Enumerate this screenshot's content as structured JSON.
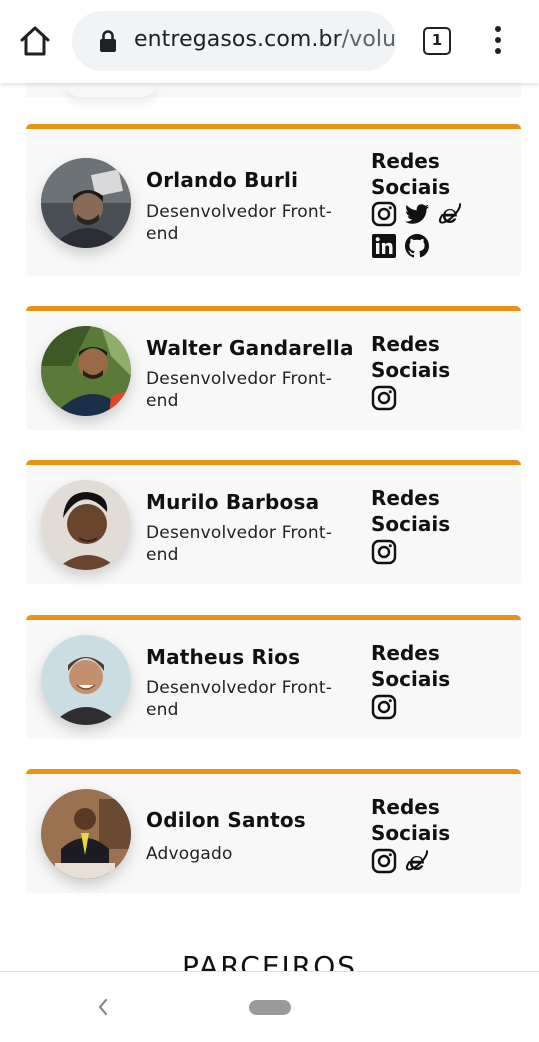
{
  "browser": {
    "url_host": "entregasos.com.br",
    "url_path": "/volu",
    "tab_count": "1"
  },
  "members": [
    {
      "name": "Orlando Burli",
      "role": "Desenvolvedor Front-end",
      "social_title": "Redes Sociais",
      "icons": [
        "instagram-icon",
        "twitter-icon",
        "internet-explorer-icon",
        "linkedin-icon",
        "github-icon"
      ]
    },
    {
      "name": "Walter Gandarella",
      "role": "Desenvolvedor Front-end",
      "social_title": "Redes Sociais",
      "icons": [
        "instagram-icon"
      ]
    },
    {
      "name": "Murilo Barbosa",
      "role": "Desenvolvedor Front-end",
      "social_title": "Redes Sociais",
      "icons": [
        "instagram-icon"
      ]
    },
    {
      "name": "Matheus Rios",
      "role": "Desenvolvedor Front-end",
      "social_title": "Redes Sociais",
      "icons": [
        "instagram-icon"
      ]
    },
    {
      "name": "Odilon Santos",
      "role": "Advogado",
      "social_title": "Redes Sociais",
      "icons": [
        "instagram-icon",
        "internet-explorer-icon"
      ]
    }
  ],
  "partners_heading": "PARCEIROS",
  "colors": {
    "accent": "#e8921a",
    "card_bg": "#f8f8f8"
  }
}
